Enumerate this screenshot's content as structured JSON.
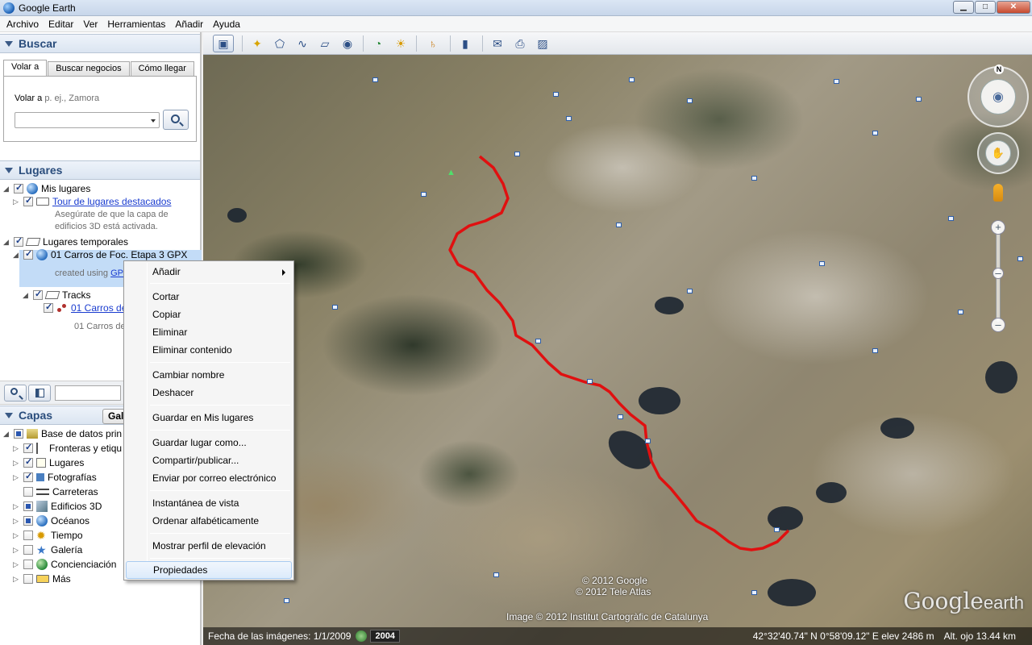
{
  "window": {
    "title": "Google Earth",
    "minimize": "▁",
    "maximize": "□",
    "close": "✕"
  },
  "menubar": [
    "Archivo",
    "Editar",
    "Ver",
    "Herramientas",
    "Añadir",
    "Ayuda"
  ],
  "search": {
    "header": "Buscar",
    "tabs": [
      "Volar a",
      "Buscar negocios",
      "Cómo llegar"
    ],
    "fly_label": "Volar a",
    "fly_placeholder": "p. ej., Zamora"
  },
  "places": {
    "header": "Lugares",
    "my_places": "Mis lugares",
    "tour": "Tour de lugares destacados",
    "tour_note_1": "Asegúrate de que la capa de",
    "tour_note_2": "edificios 3D está activada.",
    "temp_places": "Lugares temporales",
    "gpx_item": "01 Carros de Foc. Etapa 3 GPX",
    "gpx_note_prefix": "created using",
    "gpx_note_link": "GP",
    "tracks": "Tracks",
    "track_item": "01 Carros de",
    "track_note": "01 Carros de"
  },
  "layers": {
    "header": "Capas",
    "gallery_button": "Gal",
    "items": [
      "Base de datos prin",
      "Fronteras y etiqu",
      "Lugares",
      "Fotografías",
      "Carreteras",
      "Edificios 3D",
      "Océanos",
      "Tiempo",
      "Galería",
      "Concienciación",
      "Más"
    ]
  },
  "context_menu": {
    "add": "Añadir",
    "cut": "Cortar",
    "copy": "Copiar",
    "delete": "Eliminar",
    "delete_contents": "Eliminar contenido",
    "rename": "Cambiar nombre",
    "undo": "Deshacer",
    "save_my_places": "Guardar en Mis lugares",
    "save_place_as": "Guardar lugar como...",
    "share": "Compartir/publicar...",
    "email": "Enviar por correo electrónico",
    "snapshot": "Instantánea de vista",
    "sort": "Ordenar alfabéticamente",
    "elevation": "Mostrar perfil de elevación",
    "properties": "Propiedades"
  },
  "map": {
    "copyright_1": "© 2012 Google",
    "copyright_2": "© 2012 Tele Atlas",
    "copyright_3": "Image © 2012 Institut Cartogràfic de Catalunya",
    "logo_google": "Google",
    "logo_earth": "earth",
    "north": "N",
    "imagery_date": "Fecha de las imágenes: 1/1/2009",
    "year": "2004",
    "coords": "42°32'40.74\" N    0°58'09.12\" E  elev   2486 m",
    "altitude": "Alt. ojo   13.44 km"
  },
  "colors": {
    "track": "#e01010",
    "accent": "#2a4d7c",
    "selection": "#c3dcf7"
  }
}
